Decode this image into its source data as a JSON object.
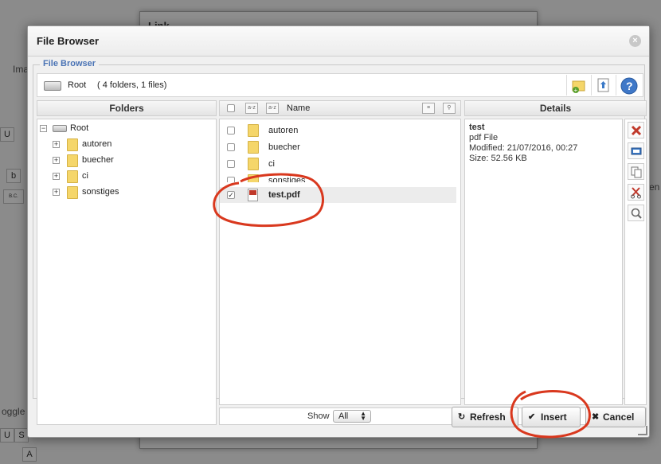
{
  "background": {
    "link_dialog_title": "Link",
    "side_texts": [
      "Ima",
      "oggle E",
      "en"
    ],
    "toolbar_glyphs": [
      "U",
      "S",
      "b",
      "a",
      "A",
      "B.C."
    ]
  },
  "dialog": {
    "title": "File Browser",
    "legend": "File Browser",
    "path": {
      "root": "Root",
      "count": "( 4 folders, 1 files)"
    },
    "toolbar_icons": [
      "new-folder-icon",
      "upload-icon",
      "help-icon"
    ]
  },
  "folders_panel": {
    "header": "Folders",
    "root": "Root",
    "items": [
      {
        "label": "autoren"
      },
      {
        "label": "buecher"
      },
      {
        "label": "ci"
      },
      {
        "label": "sonstiges"
      }
    ]
  },
  "files_panel": {
    "column_name": "Name",
    "items": [
      {
        "label": "autoren",
        "type": "folder",
        "checked": false
      },
      {
        "label": "buecher",
        "type": "folder",
        "checked": false
      },
      {
        "label": "ci",
        "type": "folder",
        "checked": false
      },
      {
        "label": "sonstiges",
        "type": "folder",
        "checked": false
      },
      {
        "label": "test.pdf",
        "type": "pdf",
        "checked": true,
        "selected": true
      }
    ],
    "show_label": "Show",
    "show_value": "All"
  },
  "details_panel": {
    "header": "Details",
    "name": "test",
    "type": "pdf File",
    "modified": "Modified: 21/07/2016, 00:27",
    "size": "Size: 52.56 KB",
    "action_icons": [
      "delete-icon",
      "rename-icon",
      "copy-icon",
      "cut-icon",
      "preview-icon"
    ]
  },
  "buttons": {
    "refresh": "Refresh",
    "insert": "Insert",
    "cancel": "Cancel"
  },
  "colors": {
    "legend": "#4a73b5",
    "annotation": "#d9381e"
  }
}
